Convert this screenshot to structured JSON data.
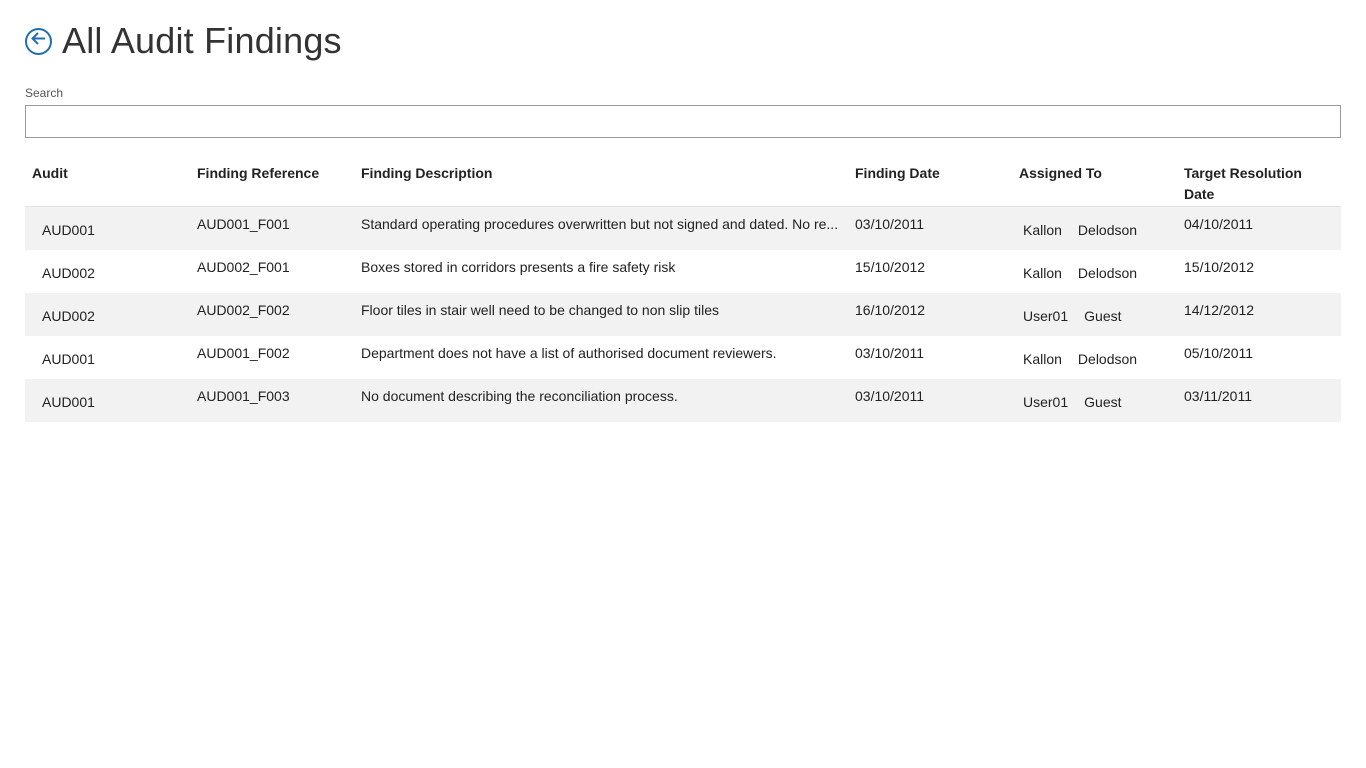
{
  "header": {
    "title": "All Audit Findings",
    "back_icon": "arrow-left-circle-icon",
    "accent_color": "#1f6fb0"
  },
  "search": {
    "label": "Search",
    "value": ""
  },
  "table": {
    "columns": {
      "audit": "Audit",
      "reference": "Finding Reference",
      "description": "Finding Description",
      "date": "Finding Date",
      "assigned": "Assigned To",
      "target": "Target Resolution Date"
    },
    "rows": [
      {
        "audit": "AUD001",
        "reference": "AUD001_F001",
        "description": "Standard operating procedures overwritten but not signed and dated. No re...",
        "date": "03/10/2011",
        "assigned_first": "Kallon",
        "assigned_last": "Delodson",
        "target": "04/10/2011"
      },
      {
        "audit": "AUD002",
        "reference": "AUD002_F001",
        "description": "Boxes stored in corridors presents a fire safety risk",
        "date": "15/10/2012",
        "assigned_first": "Kallon",
        "assigned_last": "Delodson",
        "target": "15/10/2012"
      },
      {
        "audit": "AUD002",
        "reference": "AUD002_F002",
        "description": "Floor tiles in stair well need to be changed to non slip tiles",
        "date": "16/10/2012",
        "assigned_first": "User01",
        "assigned_last": "Guest",
        "target": "14/12/2012"
      },
      {
        "audit": "AUD001",
        "reference": "AUD001_F002",
        "description": "Department does not have a list of authorised document reviewers.",
        "date": "03/10/2011",
        "assigned_first": "Kallon",
        "assigned_last": "Delodson",
        "target": "05/10/2011"
      },
      {
        "audit": "AUD001",
        "reference": "AUD001_F003",
        "description": "No document describing the reconciliation process.",
        "date": "03/10/2011",
        "assigned_first": "User01",
        "assigned_last": "Guest",
        "target": "03/11/2011"
      }
    ]
  }
}
